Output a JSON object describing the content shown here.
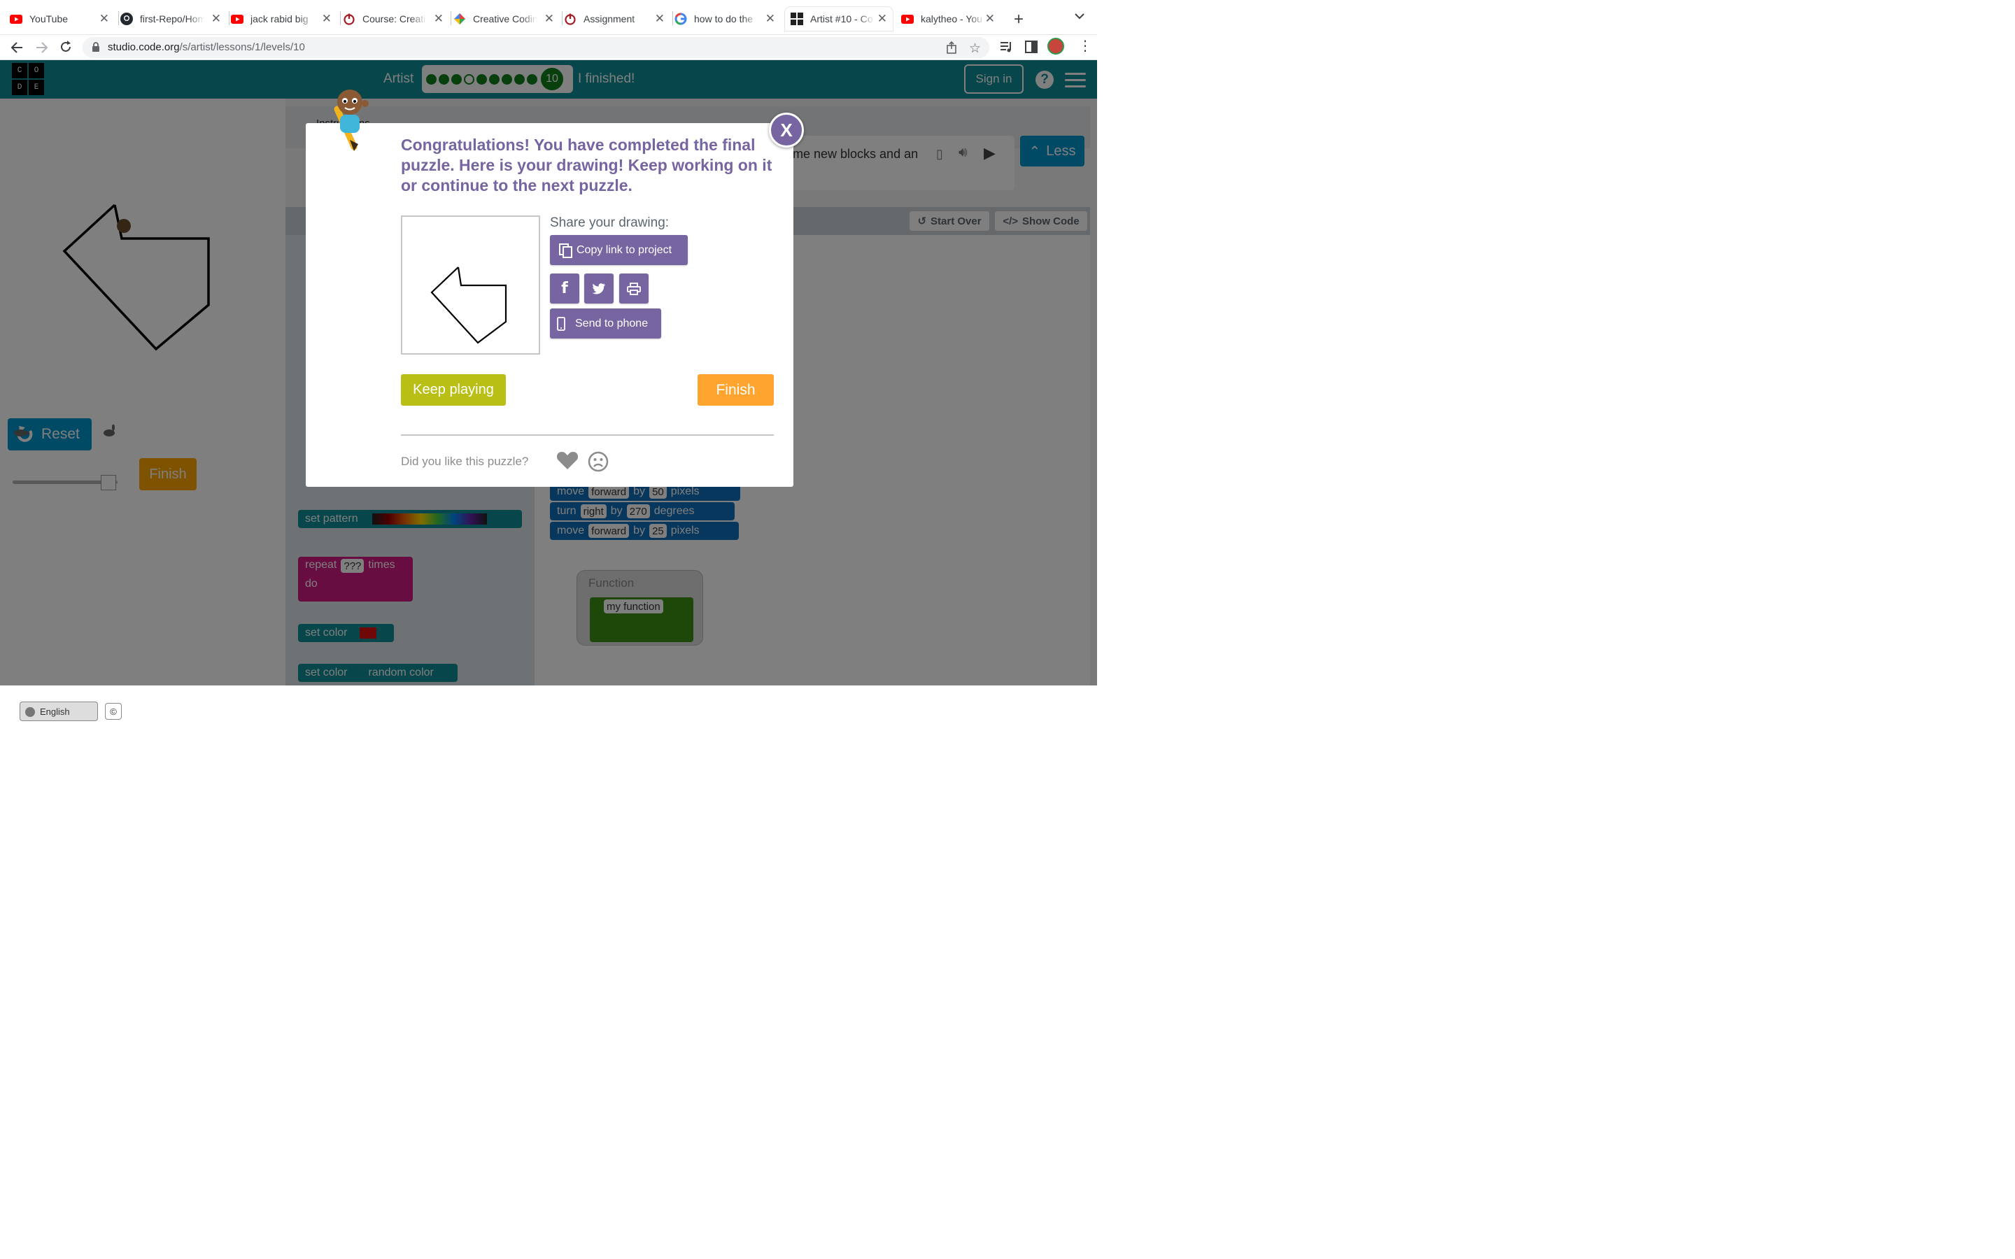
{
  "browser": {
    "tabs": [
      {
        "title": "YouTube",
        "icon": "youtube-icon"
      },
      {
        "title": "first-Repo/Hom",
        "icon": "github-icon"
      },
      {
        "title": "jack rabid big",
        "icon": "youtube-icon"
      },
      {
        "title": "Course: Creati",
        "icon": "power-icon"
      },
      {
        "title": "Creative Codin",
        "icon": "gem-icon"
      },
      {
        "title": "Assignment",
        "icon": "power-icon"
      },
      {
        "title": "how to do the",
        "icon": "google-icon"
      },
      {
        "title": "Artist #10 - Co",
        "icon": "code-org-icon",
        "active": true
      },
      {
        "title": "kalytheo - You",
        "icon": "youtube-icon"
      }
    ],
    "url_host": "studio.code.org",
    "url_path": "/s/artist/lessons/1/levels/10"
  },
  "header": {
    "logo_letters": [
      "C",
      "O",
      "D",
      "E"
    ],
    "level_title": "Artist",
    "current_level": "10",
    "finished_text": "I finished!",
    "sign_in": "Sign in",
    "help": "?"
  },
  "left_panel": {
    "reset": "Reset",
    "finish": "Finish",
    "language": "English",
    "copyright": "©"
  },
  "workspace": {
    "instructions_tab": "Instructions",
    "instructions_text": "me new blocks and an",
    "less": "Less",
    "start_over": "Start Over",
    "show_code": "Show Code",
    "toolbox_blocks": {
      "set_pattern": "set pattern",
      "repeat": "repeat",
      "repeat_field": "???",
      "repeat_times": "times",
      "repeat_do": "do",
      "set_color_1": "set color",
      "set_color_2": "set color",
      "random_color": "random color"
    },
    "code_blocks": [
      {
        "verb": "move",
        "dir": "forward",
        "by": "by",
        "value": "50",
        "unit": "pixels"
      },
      {
        "verb": "turn",
        "dir": "right",
        "by": "by",
        "value": "270",
        "unit": "degrees"
      },
      {
        "verb": "move",
        "dir": "forward",
        "by": "by",
        "value": "25",
        "unit": "pixels"
      }
    ],
    "function_label": "Function",
    "function_name": "my function"
  },
  "modal": {
    "title": "Congratulations! You have completed the final puzzle. Here is your drawing! Keep working on it or continue to the next puzzle.",
    "share_label": "Share your drawing:",
    "copy_link": "Copy link to project",
    "send_to_phone": "Send to phone",
    "keep_playing": "Keep playing",
    "finish": "Finish",
    "feedback_question": "Did you like this puzzle?",
    "close": "X"
  },
  "colors": {
    "accent_purple": "#7665a0",
    "keep_playing_green": "#b9bf15",
    "finish_orange": "#ffa42e",
    "header_teal": "#0e8e96"
  }
}
